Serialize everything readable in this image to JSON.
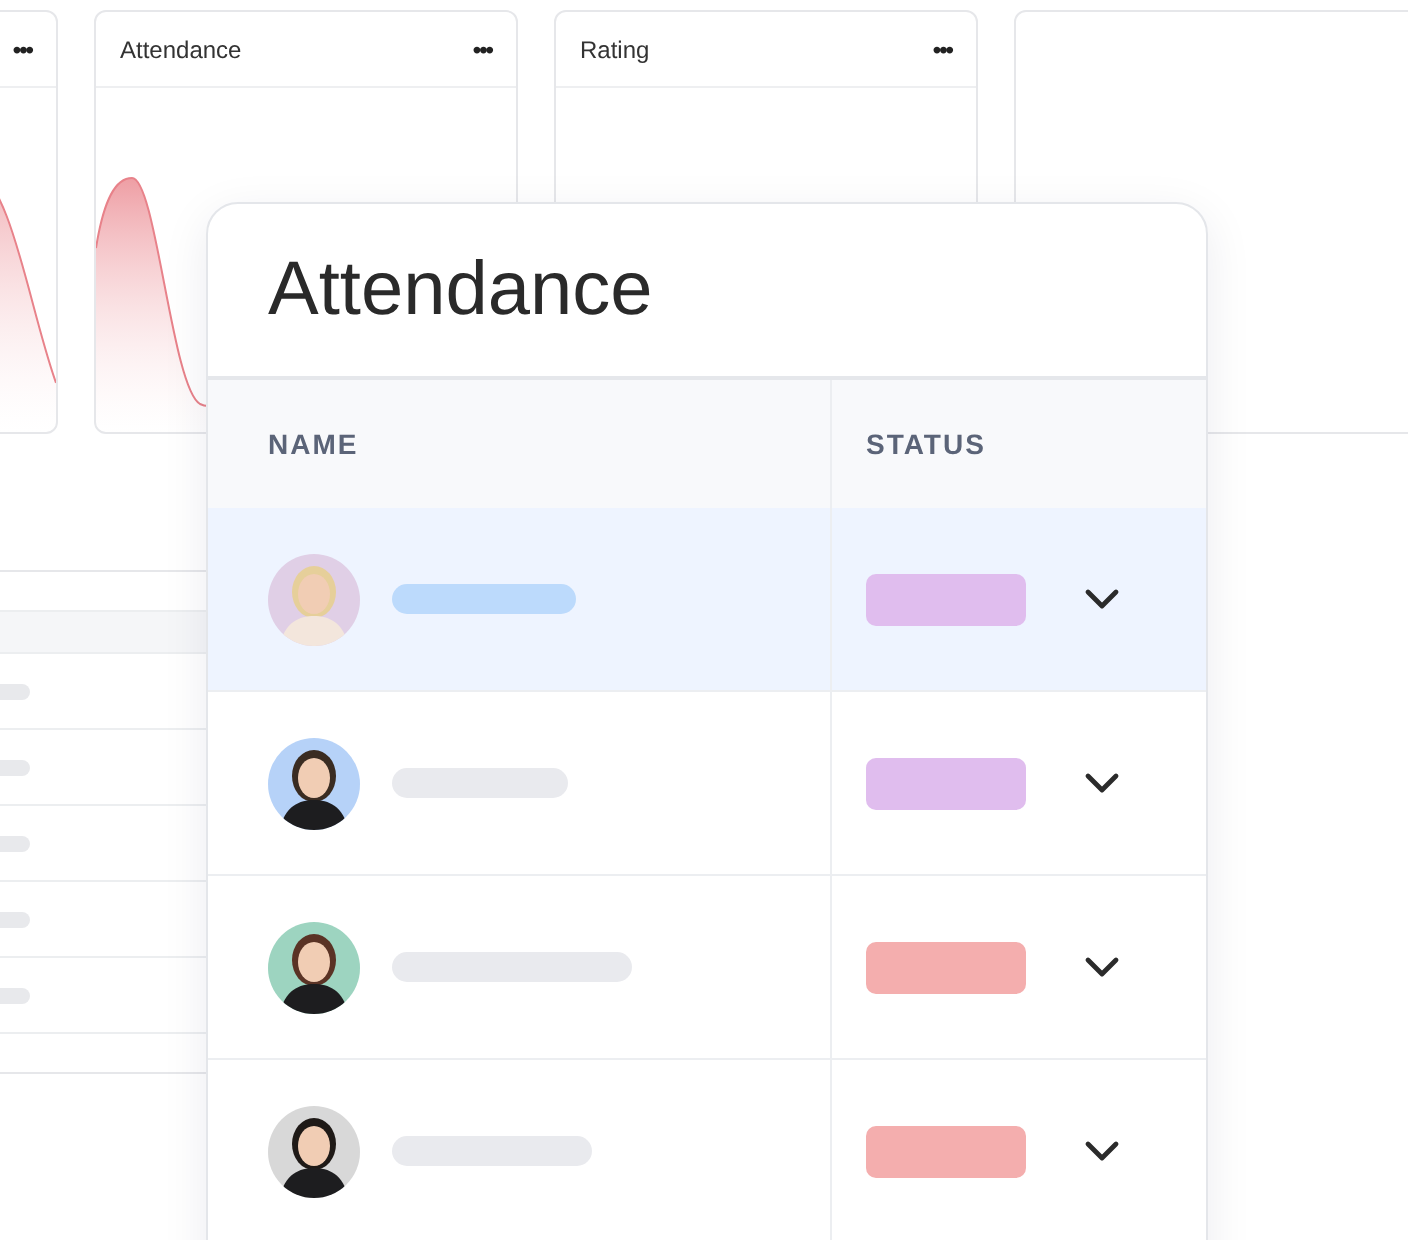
{
  "dashboard_cards": [
    {
      "kind": "chart",
      "menu": "•••"
    },
    {
      "kind": "chart",
      "title": "Attendance",
      "menu": "•••"
    },
    {
      "kind": "empty",
      "title": "Rating",
      "menu": "•••"
    },
    {
      "kind": "empty"
    }
  ],
  "attendance_panel": {
    "title": "Attendance",
    "columns": [
      "NAME",
      "STATUS"
    ],
    "rows": [
      {
        "selected": true,
        "color": "#e0bdee"
      },
      {
        "selected": false,
        "color": "#e0bdee"
      },
      {
        "selected": false,
        "color": "#f4aeae"
      },
      {
        "selected": false,
        "color": "#f4aeae"
      }
    ]
  }
}
